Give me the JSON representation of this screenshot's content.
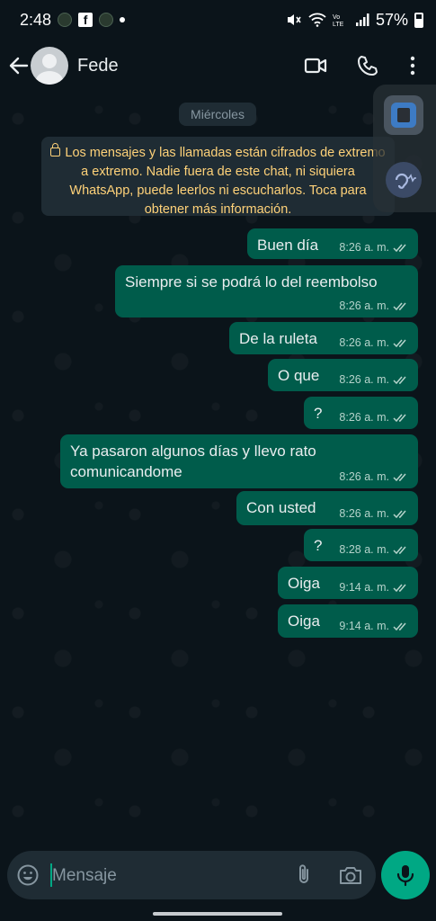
{
  "status_bar": {
    "time": "2:48",
    "battery": "57%"
  },
  "header": {
    "contact_name": "Fede"
  },
  "chat": {
    "date_label": "Miércoles",
    "encryption_notice": "Los mensajes y las llamadas están cifrados de extremo a extremo. Nadie fuera de este chat, ni siquiera WhatsApp, puede leerlos ni escucharlos. Toca para obtener más información.",
    "messages": [
      {
        "text": "Buen día",
        "time": "8:26 a. m."
      },
      {
        "text": "Siempre si se podrá lo del reembolso",
        "time": "8:26 a. m."
      },
      {
        "text": "De la ruleta",
        "time": "8:26 a. m."
      },
      {
        "text": "O que",
        "time": "8:26 a. m."
      },
      {
        "text": "?",
        "time": "8:26 a. m."
      },
      {
        "text": "Ya pasaron algunos días y llevo rato comunicandome",
        "time": "8:26 a. m."
      },
      {
        "text": "Con usted",
        "time": "8:26 a. m."
      },
      {
        "text": "?",
        "time": "8:28 a. m."
      },
      {
        "text": "Oiga",
        "time": "9:14 a. m."
      },
      {
        "text": "Oiga",
        "time": "9:14 a. m."
      }
    ]
  },
  "composer": {
    "placeholder": "Mensaje"
  },
  "colors": {
    "accent": "#00a884",
    "bubble_out": "#005c4b",
    "background": "#0b141a",
    "notice_text": "#ffd279"
  }
}
